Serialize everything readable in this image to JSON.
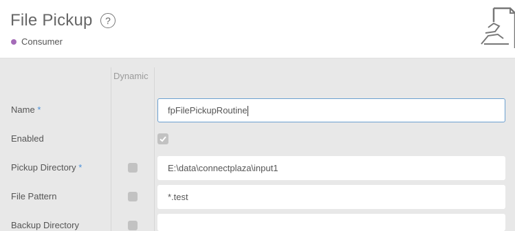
{
  "header": {
    "title": "File Pickup",
    "help_glyph": "?",
    "type_label": "Consumer",
    "type_color": "#a46bb8",
    "icon": "hand-holding-document-icon"
  },
  "columns": {
    "dynamic_header": "Dynamic"
  },
  "form": {
    "name": {
      "label": "Name",
      "required_mark": "*",
      "value": "fpFilePickupRoutine"
    },
    "enabled": {
      "label": "Enabled",
      "checked": true
    },
    "pickup_directory": {
      "label": "Pickup Directory",
      "required_mark": "*",
      "value": "E:\\data\\connectplaza\\input1",
      "dynamic": false
    },
    "file_pattern": {
      "label": "File Pattern",
      "value": "*.test",
      "dynamic": false
    },
    "backup_directory": {
      "label": "Backup Directory",
      "value": "",
      "dynamic": false
    }
  },
  "colors": {
    "required": "#4a90d9",
    "focus_border": "#6a9fd0"
  }
}
